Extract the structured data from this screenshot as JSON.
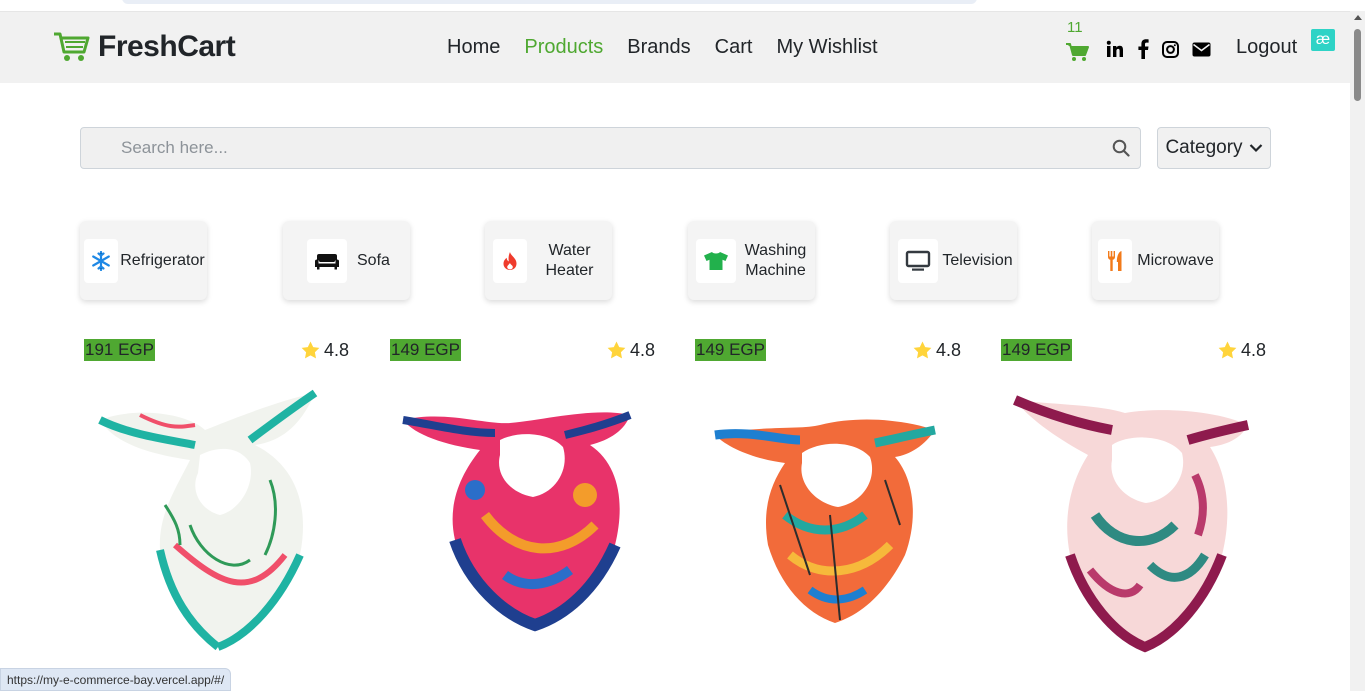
{
  "brand": {
    "name": "FreshCart"
  },
  "nav": {
    "links": [
      {
        "label": "Home",
        "active": false
      },
      {
        "label": "Products",
        "active": true
      },
      {
        "label": "Brands",
        "active": false
      },
      {
        "label": "Cart",
        "active": false
      },
      {
        "label": "My Wishlist",
        "active": false
      }
    ],
    "cart_count": "11",
    "socials": [
      "linkedin-icon",
      "facebook-icon",
      "instagram-icon",
      "envelope-icon"
    ],
    "logout_label": "Logout",
    "extension_badge": "æ"
  },
  "search": {
    "placeholder": "Search here...",
    "value": ""
  },
  "category_button": {
    "label": "Category"
  },
  "categories": [
    {
      "label": "Refrigerator",
      "icon": "snowflake-icon",
      "color": "#1e88e5"
    },
    {
      "label": "Sofa",
      "icon": "sofa-icon",
      "color": "#111111"
    },
    {
      "label": "Water Heater",
      "icon": "fire-icon",
      "color": "#ef3b2c"
    },
    {
      "label": "Washing Machine",
      "icon": "tshirt-icon",
      "color": "#22b14c"
    },
    {
      "label": "Television",
      "icon": "monitor-icon",
      "color": "#343a40"
    },
    {
      "label": "Microwave",
      "icon": "utensils-icon",
      "color": "#f27a1a"
    }
  ],
  "products": [
    {
      "price": "191 EGP",
      "rating": "4.8"
    },
    {
      "price": "149 EGP",
      "rating": "4.8"
    },
    {
      "price": "149 EGP",
      "rating": "4.8"
    },
    {
      "price": "149 EGP",
      "rating": "4.8"
    }
  ],
  "statusbar": {
    "url": "https://my-e-commerce-bay.vercel.app/#/"
  },
  "colors": {
    "accent": "#4fa831",
    "navbar_bg": "#f1f1f1",
    "star": "#ffd43b"
  }
}
